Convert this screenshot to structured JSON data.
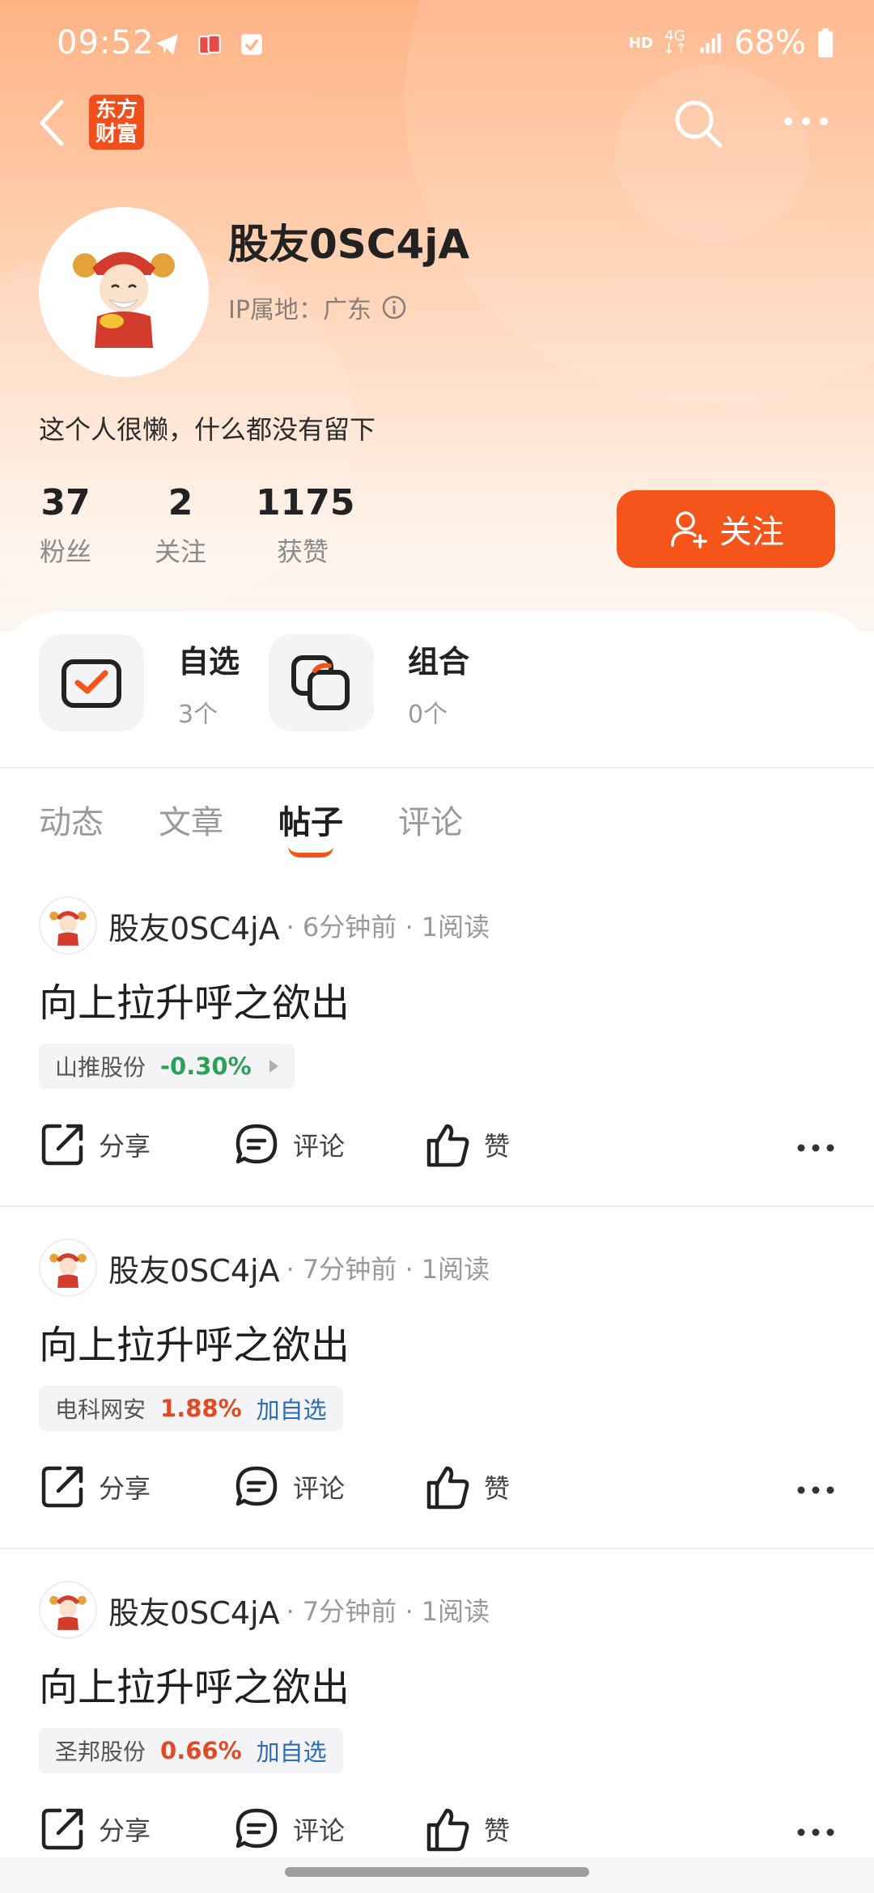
{
  "status_bar": {
    "time": "09:52",
    "hd": "HD",
    "network": "4G",
    "battery": "68%"
  },
  "nav": {
    "logo_line1": "东方",
    "logo_line2": "财富"
  },
  "profile": {
    "name": "股友0SC4jA",
    "ip_location": "IP属地：广东",
    "bio": "这个人很懒，什么都没有留下",
    "stats": [
      {
        "value": "37",
        "label": "粉丝"
      },
      {
        "value": "2",
        "label": "关注"
      },
      {
        "value": "1175",
        "label": "获赞"
      }
    ],
    "follow_label": "关注"
  },
  "quick": {
    "watchlist_title": "自选",
    "watchlist_count": "3个",
    "portfolio_title": "组合",
    "portfolio_count": "0个"
  },
  "tabs": [
    {
      "label": "动态",
      "active": false
    },
    {
      "label": "文章",
      "active": false
    },
    {
      "label": "帖子",
      "active": true
    },
    {
      "label": "评论",
      "active": false
    }
  ],
  "posts": [
    {
      "author": "股友0SC4jA",
      "meta": "· 6分钟前 · 1阅读",
      "content": "向上拉升呼之欲出",
      "stock": "山推股份",
      "pct": "-0.30%",
      "add": ""
    },
    {
      "author": "股友0SC4jA",
      "meta": "· 7分钟前 · 1阅读",
      "content": "向上拉升呼之欲出",
      "stock": "电科网安",
      "pct": "1.88%",
      "add": "加自选"
    },
    {
      "author": "股友0SC4jA",
      "meta": "· 7分钟前 · 1阅读",
      "content": "向上拉升呼之欲出",
      "stock": "圣邦股份",
      "pct": "0.66%",
      "add": "加自选"
    }
  ],
  "actions": {
    "share": "分享",
    "comment": "评论",
    "like": "赞"
  },
  "colors": {
    "accent": "#f5541a",
    "down": "#2aa35a",
    "up": "#e24a26",
    "link": "#2e6db4"
  }
}
